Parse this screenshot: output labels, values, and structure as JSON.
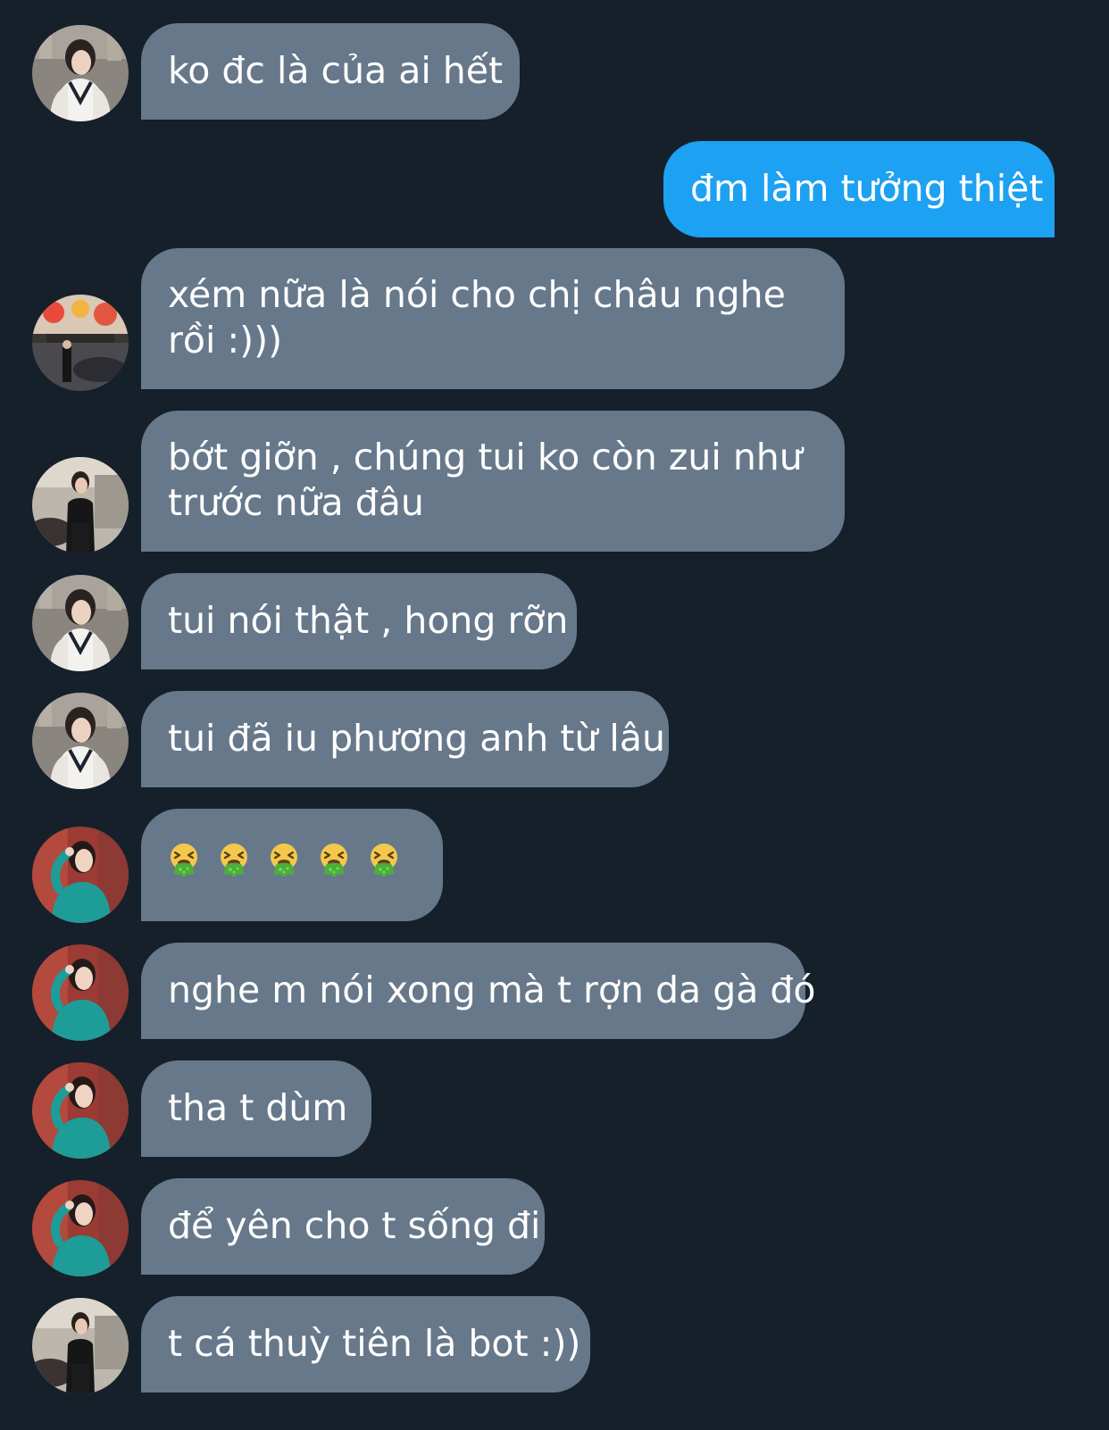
{
  "messages": [
    {
      "text": "ko đc là của ai hết",
      "sender": "received",
      "avatar": "avatar-white-vest"
    },
    {
      "text": "đm làm tưởng thiệt",
      "sender": "sent",
      "avatar": ""
    },
    {
      "text": "xém nữa là nói cho chị châu nghe rồi :)))",
      "sender": "received",
      "avatar": "avatar-street-storefront"
    },
    {
      "text": "bớt giỡn , chúng tui ko còn zui như trước nữa đâu",
      "sender": "received",
      "avatar": "avatar-black-outfit"
    },
    {
      "text": "tui nói thật , hong rỡn",
      "sender": "received",
      "avatar": "avatar-white-vest"
    },
    {
      "text": "tui đã iu phương anh từ lâu",
      "sender": "received",
      "avatar": "avatar-white-vest"
    },
    {
      "text": "",
      "sender": "received",
      "avatar": "avatar-teal-dress",
      "emoji": [
        "vomiting-face-emoji",
        "vomiting-face-emoji",
        "vomiting-face-emoji",
        "vomiting-face-emoji",
        "vomiting-face-emoji"
      ]
    },
    {
      "text": "nghe m nói xong mà t rợn da gà đó",
      "sender": "received",
      "avatar": "avatar-teal-dress"
    },
    {
      "text": "tha t dùm",
      "sender": "received",
      "avatar": "avatar-teal-dress"
    },
    {
      "text": "để yên cho t sống đi",
      "sender": "received",
      "avatar": "avatar-teal-dress"
    },
    {
      "text": "t cá thuỳ tiên là bot :))",
      "sender": "received",
      "avatar": "avatar-black-outfit"
    }
  ],
  "colors": {
    "background": "#15202b",
    "received_bubble": "#67788a",
    "sent_bubble": "#1da1f2",
    "text": "#ffffff"
  }
}
